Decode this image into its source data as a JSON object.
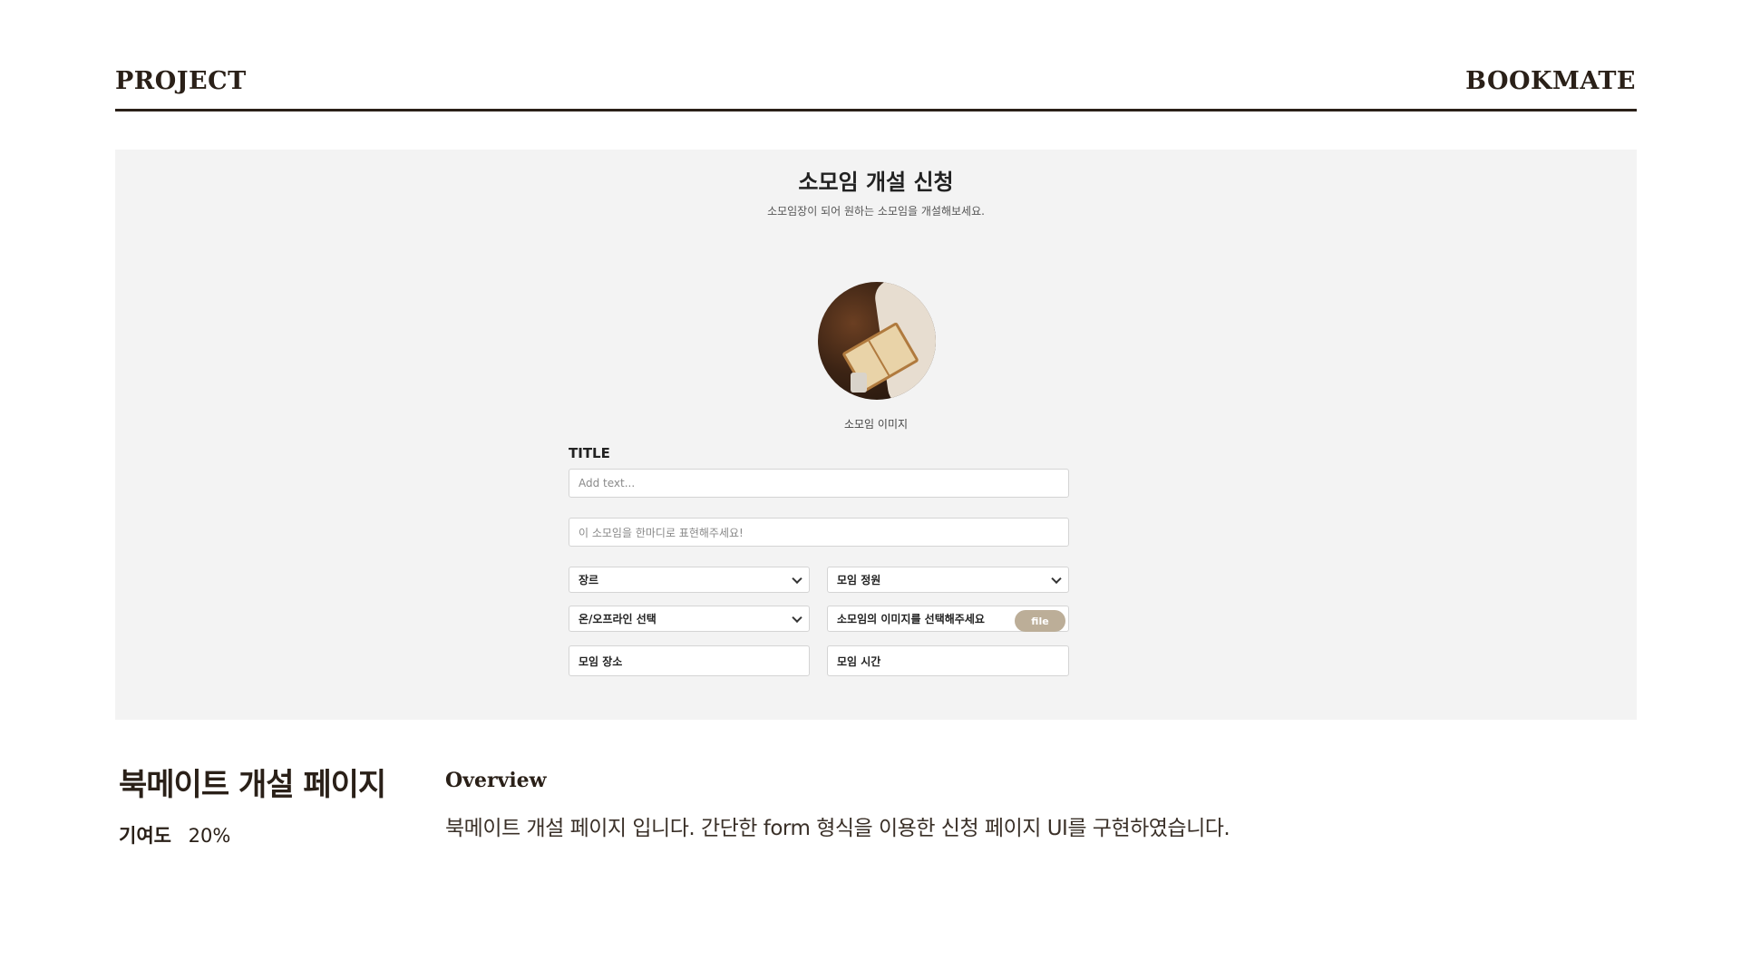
{
  "header": {
    "left": "PROJECT",
    "right": "BOOKMATE"
  },
  "screenshot": {
    "title": "소모임 개설 신청",
    "subtitle": "소모임장이 되어 원하는 소모임을 개설해보세요.",
    "image_label": "소모임 이미지",
    "title_label": "TITLE",
    "title_placeholder": "Add text...",
    "summary_placeholder": "이 소모임을 한마디로 표현해주세요!",
    "genre_select": "장르",
    "capacity_select": "모임 정원",
    "online_select": "온/오프라인 선택",
    "image_select_text": "소모임의 이미지를 선택해주세요",
    "file_button": "file",
    "place_field": "모임 장소",
    "time_field": "모임 시간"
  },
  "project": {
    "title": "북메이트 개설 페이지",
    "contribution_label": "기여도",
    "contribution_value": "20%",
    "overview_heading": "Overview",
    "overview_text": "북메이트 개설 페이지 입니다.  간단한 form 형식을 이용한 신청 페이지 UI를 구현하였습니다."
  }
}
